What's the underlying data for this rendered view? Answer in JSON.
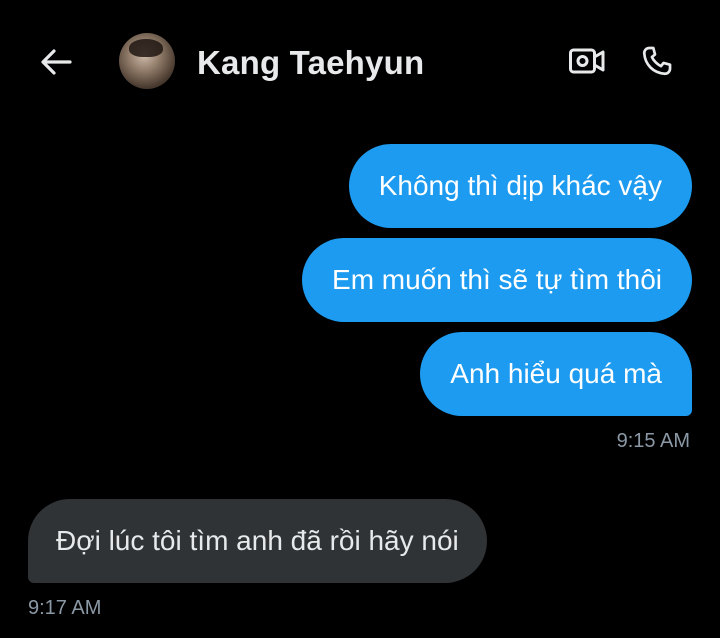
{
  "header": {
    "title": "Kang Taehyun",
    "back_icon": "arrow-left-icon",
    "video_icon": "video-call-icon",
    "call_icon": "phone-icon"
  },
  "messages": [
    {
      "text": "Không thì dịp khác vậy",
      "direction": "outgoing"
    },
    {
      "text": "Em muốn thì sẽ tự tìm thôi",
      "direction": "outgoing"
    },
    {
      "text": "Anh hiểu quá mà",
      "direction": "outgoing"
    },
    {
      "text": "Đợi lúc tôi tìm anh đã rồi hãy nói",
      "direction": "incoming"
    }
  ],
  "timestamps": {
    "outgoing_group": "9:15 AM",
    "incoming_group": "9:17 AM"
  },
  "colors": {
    "background": "#000000",
    "outgoing_bubble": "#1d9bf0",
    "incoming_bubble": "#2f3336",
    "timestamp": "#8b98a5"
  }
}
